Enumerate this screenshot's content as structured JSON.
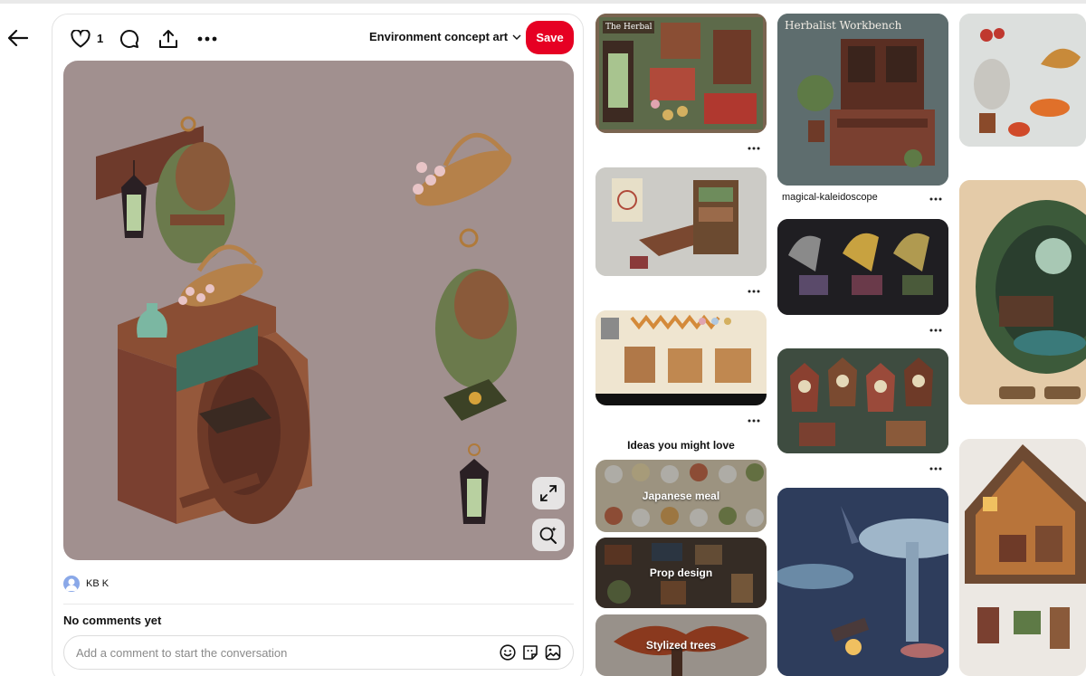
{
  "pin": {
    "like_count": "1",
    "board_name": "Environment concept art",
    "save_label": "Save",
    "author_name": "KB K",
    "comments_heading": "No comments yet",
    "comment_placeholder": "Add a comment to start the conversation"
  },
  "feed": {
    "pin_herbalist_title": "magical-kaleidoscope",
    "ideas_heading": "Ideas you might love",
    "ideas": [
      {
        "label": "Japanese meal"
      },
      {
        "label": "Prop design"
      },
      {
        "label": "Stylized trees"
      }
    ],
    "overlay_texts": {
      "herbalist": "Herbalist Workbench",
      "herbal_shop": "The Herbal"
    }
  },
  "icons": [
    "back-arrow-icon",
    "heart-icon",
    "comment-icon",
    "share-icon",
    "more-icon",
    "chevron-down-icon",
    "expand-icon",
    "visual-search-icon",
    "emoji-icon",
    "sticker-icon",
    "image-icon"
  ],
  "colors": {
    "save_button": "#e60023",
    "image_background": "#a1908f"
  }
}
